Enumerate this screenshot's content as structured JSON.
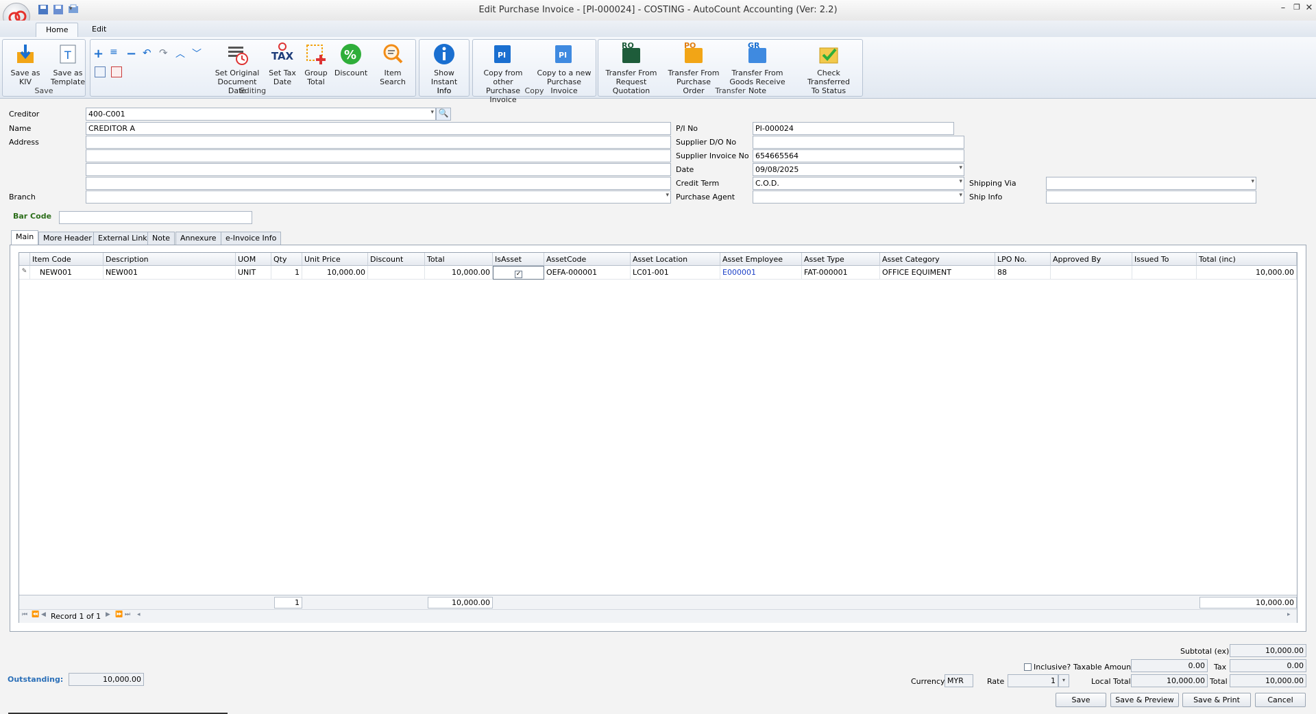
{
  "window": {
    "title": "Edit Purchase Invoice - [PI-000024] - COSTING - AutoCount Accounting (Ver: 2.2)"
  },
  "ribbon_tabs": [
    "Home",
    "Edit"
  ],
  "ribbon": {
    "groups": {
      "save": "Save",
      "editing": "Editing",
      "info": "Info",
      "copy": "Copy",
      "transfer": "Transfer"
    },
    "buttons": {
      "save_kiv": "Save as KIV",
      "save_template_1": "Save as",
      "save_template_2": "Template",
      "set_original_1": "Set Original",
      "set_original_2": "Document Date",
      "set_tax_1": "Set Tax",
      "set_tax_2": "Date",
      "group_total_1": "Group",
      "group_total_2": "Total",
      "discount": "Discount",
      "item_search": "Item Search",
      "show_instant_1": "Show Instant",
      "show_instant_2": "Info",
      "copy_from_1": "Copy from other",
      "copy_from_2": "Purchase Invoice",
      "copy_to_1": "Copy to a new",
      "copy_to_2": "Purchase Invoice",
      "rq_1": "Transfer From",
      "rq_2": "Request Quotation",
      "po_1": "Transfer From",
      "po_2": "Purchase Order",
      "gr_1": "Transfer From",
      "gr_2": "Goods Receive Note",
      "check_1": "Check Transferred",
      "check_2": "To Status"
    },
    "icon_text": {
      "tax": "TAX",
      "pi": "PI",
      "rq": "RQ",
      "po": "PO",
      "gr": "GR"
    }
  },
  "form": {
    "labels": {
      "creditor": "Creditor",
      "name": "Name",
      "address": "Address",
      "branch": "Branch",
      "pi_no": "P/I No",
      "supplier_do": "Supplier D/O No",
      "supplier_inv": "Supplier Invoice No",
      "date": "Date",
      "credit_term": "Credit Term",
      "purchase_agent": "Purchase Agent",
      "shipping_via": "Shipping Via",
      "ship_info": "Ship Info",
      "bar_code": "Bar Code"
    },
    "values": {
      "creditor": "400-C001",
      "name": "CREDITOR A",
      "pi_no": "PI-000024",
      "supplier_inv": "654665564",
      "date": "09/08/2025",
      "credit_term": "C.O.D."
    }
  },
  "doc_tabs": [
    "Main",
    "More Header",
    "External Link",
    "Note",
    "Annexure",
    "e-Invoice Info"
  ],
  "grid": {
    "columns": [
      "Item Code",
      "Description",
      "UOM",
      "Qty",
      "Unit Price",
      "Discount",
      "Total",
      "IsAsset",
      "AssetCode",
      "Asset Location",
      "Asset Employee",
      "Asset Type",
      "Asset Category",
      "LPO No.",
      "Approved By",
      "Issued To",
      "Total (inc)"
    ],
    "rows": [
      {
        "item_code": "NEW001",
        "description": "NEW001",
        "uom": "UNIT",
        "qty": "1",
        "unit_price": "10,000.00",
        "discount": "",
        "total": "10,000.00",
        "is_asset": true,
        "asset_code": "OEFA-000001",
        "asset_location": "LC01-001",
        "asset_employee": "E000001",
        "asset_type": "FAT-000001",
        "asset_category": "OFFICE EQUIMENT",
        "lpo_no": "88",
        "approved_by": "",
        "issued_to": "",
        "total_inc": "10,000.00"
      }
    ],
    "footer": {
      "qty": "1",
      "total": "10,000.00",
      "total_inc": "10,000.00"
    },
    "record_nav": "Record 1 of 1"
  },
  "summary": {
    "outstanding_label": "Outstanding:",
    "outstanding": "10,000.00",
    "subtotal_label": "Subtotal (ex)",
    "subtotal": "10,000.00",
    "inclusive_label": "Inclusive?",
    "taxable_label": "Taxable Amount",
    "taxable": "0.00",
    "tax_label": "Tax",
    "tax": "0.00",
    "currency_label": "Currency",
    "currency": "MYR",
    "rate_label": "Rate",
    "rate": "1",
    "local_total_label": "Local Total",
    "local_total": "10,000.00",
    "total_label": "Total",
    "total": "10,000.00"
  },
  "buttons": {
    "save": "Save",
    "save_preview": "Save & Preview",
    "save_print": "Save & Print",
    "cancel": "Cancel"
  }
}
